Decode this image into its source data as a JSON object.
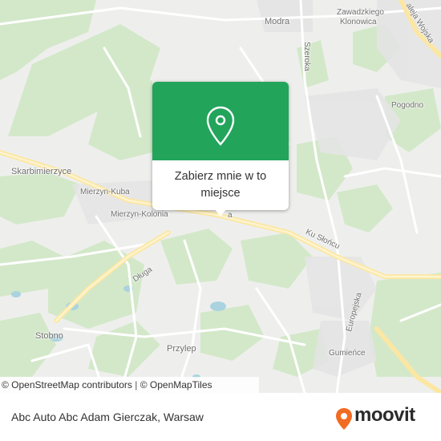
{
  "map": {
    "labels": {
      "modra": "Modra",
      "zawadzkiego_line1": "Zawadzkiego",
      "zawadzkiego_line2": "Klonowica",
      "aleja_wojska": "aleja Wojska",
      "szeroka": "Szeroka",
      "pogodno": "Pogodno",
      "skarbimierzyce": "Skarbimierzyce",
      "mierzyn_kuba": "Mierzyn-Kuba",
      "mierzyn_kolonia": "Mierzyn-Kolonia",
      "road_stub": "a",
      "ku_sloncu": "Ku Słońcu",
      "dluga": "Długa",
      "europejska": "Europejska",
      "stobno": "Stobno",
      "przylep": "Przylep",
      "gumience": "Gumieńce"
    },
    "popup": {
      "cta_line1": "Zabierz mnie w to",
      "cta_line2": "miejsce"
    },
    "attribution": {
      "osm_contributors": "© OpenStreetMap contributors",
      "separator": "|",
      "openmaptiles": "© OpenMapTiles"
    }
  },
  "footer": {
    "place_name": "Abc Auto Abc Adam Gierczak, Warsaw",
    "brand": "moovit"
  },
  "colors": {
    "popup_green": "#22a45b",
    "moovit_orange": "#f26b22",
    "park_green": "#cfe6c4",
    "road_yellow": "#fbeaa9"
  }
}
